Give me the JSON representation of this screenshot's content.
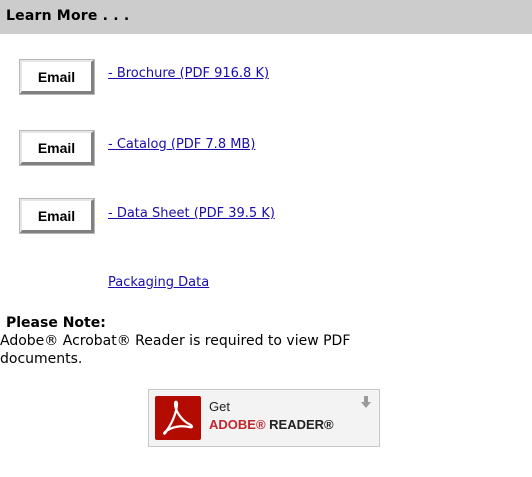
{
  "header": {
    "title": "Learn More . . ."
  },
  "documents": [
    {
      "email_label": "Email",
      "link_text": "- Brochure (PDF 916.8 K)"
    },
    {
      "email_label": "Email",
      "link_text": "- Catalog (PDF 7.8 MB)"
    },
    {
      "email_label": "Email",
      "link_text": "- Data Sheet (PDF 39.5 K)"
    }
  ],
  "packaging": {
    "link_text": "Packaging Data"
  },
  "note": {
    "title": "Please Note:",
    "text": "Adobe® Acrobat® Reader is required to view PDF documents."
  },
  "adobe_badge": {
    "get_text": "Get",
    "brand_text": "ADOBE®",
    "product_text": " READER®",
    "logo_icon": "acrobat-logo-icon",
    "download_icon": "download-arrow-icon"
  }
}
